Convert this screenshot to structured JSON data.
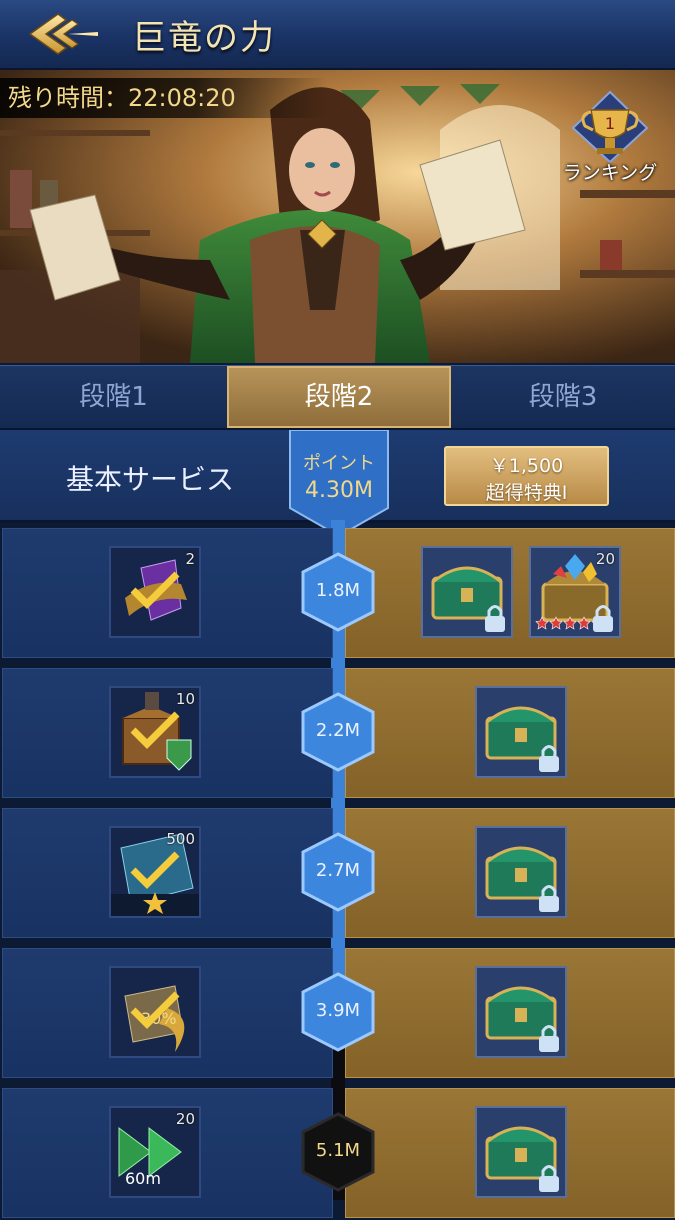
{
  "header": {
    "title": "巨竜の力"
  },
  "banner": {
    "timer_text": "残り時間：22:08:20",
    "ranking_label": "ランキング",
    "ranking_rank": "1"
  },
  "tabs": [
    {
      "label": "段階1",
      "active": false
    },
    {
      "label": "段階2",
      "active": true
    },
    {
      "label": "段階3",
      "active": false
    }
  ],
  "info": {
    "basic_label": "基本サービス",
    "points_label": "ポイント",
    "points_value": "4.30M",
    "buy_price": "￥1,500",
    "buy_name": "超得特典I"
  },
  "rows": [
    {
      "milestone": "1.8M",
      "free_qty": "2",
      "premium_qty": [
        "",
        "20"
      ],
      "premium_stars": 5
    },
    {
      "milestone": "2.2M",
      "free_qty": "10",
      "premium_qty": [
        ""
      ]
    },
    {
      "milestone": "2.7M",
      "free_qty": "500",
      "premium_qty": [
        ""
      ]
    },
    {
      "milestone": "3.9M",
      "free_qty": "",
      "free_badge": "30%",
      "premium_qty": [
        ""
      ]
    },
    {
      "milestone": "5.1M",
      "free_qty": "20",
      "free_badge": "60m",
      "premium_qty": [
        ""
      ]
    }
  ],
  "colors": {
    "track_blue": "#3b82d8",
    "gold_text": "#f1d88a",
    "premium_panel": "#9a7636",
    "free_panel": "#1f3b6e"
  }
}
